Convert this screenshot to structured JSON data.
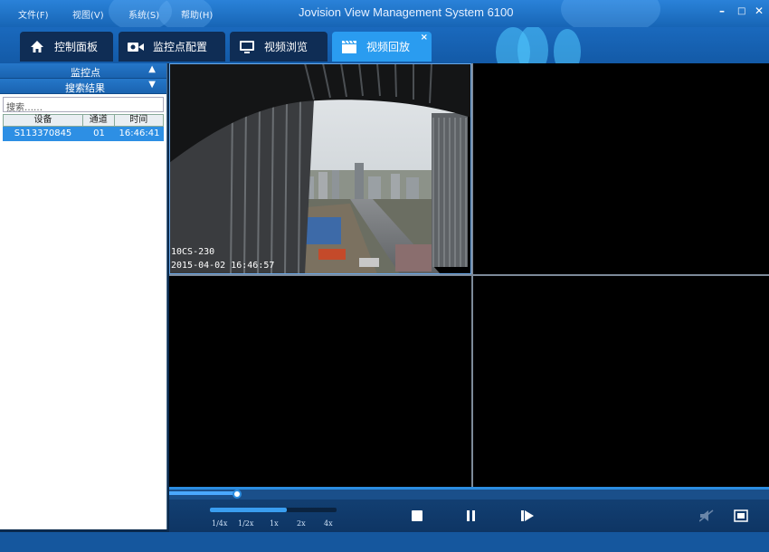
{
  "menubar": {
    "items": [
      {
        "label": "文件(F)"
      },
      {
        "label": "视图(V)"
      },
      {
        "label": "系统(S)"
      },
      {
        "label": "帮助(H)"
      }
    ],
    "title": "Jovision View Management System 6100",
    "controls": {
      "minimize": "–",
      "maximize": "□",
      "close": "✕"
    }
  },
  "tabs": [
    {
      "label": "控制面板",
      "icon": "home-icon"
    },
    {
      "label": "监控点配置",
      "icon": "camera-icon"
    },
    {
      "label": "视频浏览",
      "icon": "monitor-icon"
    },
    {
      "label": "视频回放",
      "icon": "clapper-icon",
      "active": true,
      "close": "×"
    }
  ],
  "sidebar": {
    "sections": [
      {
        "label": "监控点",
        "chevron": "▲"
      },
      {
        "label": "搜索结果",
        "chevron": "▼"
      }
    ],
    "search_value": "搜索……",
    "table": {
      "headers": [
        "设备",
        "通道",
        "时间"
      ],
      "rows": [
        [
          "S113370845",
          "01",
          "16:46:41"
        ]
      ]
    }
  },
  "video": {
    "panes": [
      {
        "camera": "10CS-230",
        "timestamp": "2015-04-02 16:46:57",
        "selected": true
      },
      {
        "camera": "",
        "timestamp": ""
      },
      {
        "camera": "",
        "timestamp": ""
      },
      {
        "camera": "",
        "timestamp": ""
      }
    ]
  },
  "playback": {
    "speeds": [
      "1/4x",
      "1/2x",
      "1x",
      "2x",
      "4x"
    ],
    "buttons": [
      "stop-icon",
      "pause-icon",
      "step-forward-icon",
      "mute-icon",
      "fullscreen-icon"
    ]
  },
  "colors": {
    "accent": "#2b8de0",
    "selection": "#2d8fe4",
    "active_tab": "#2a9cf0"
  }
}
